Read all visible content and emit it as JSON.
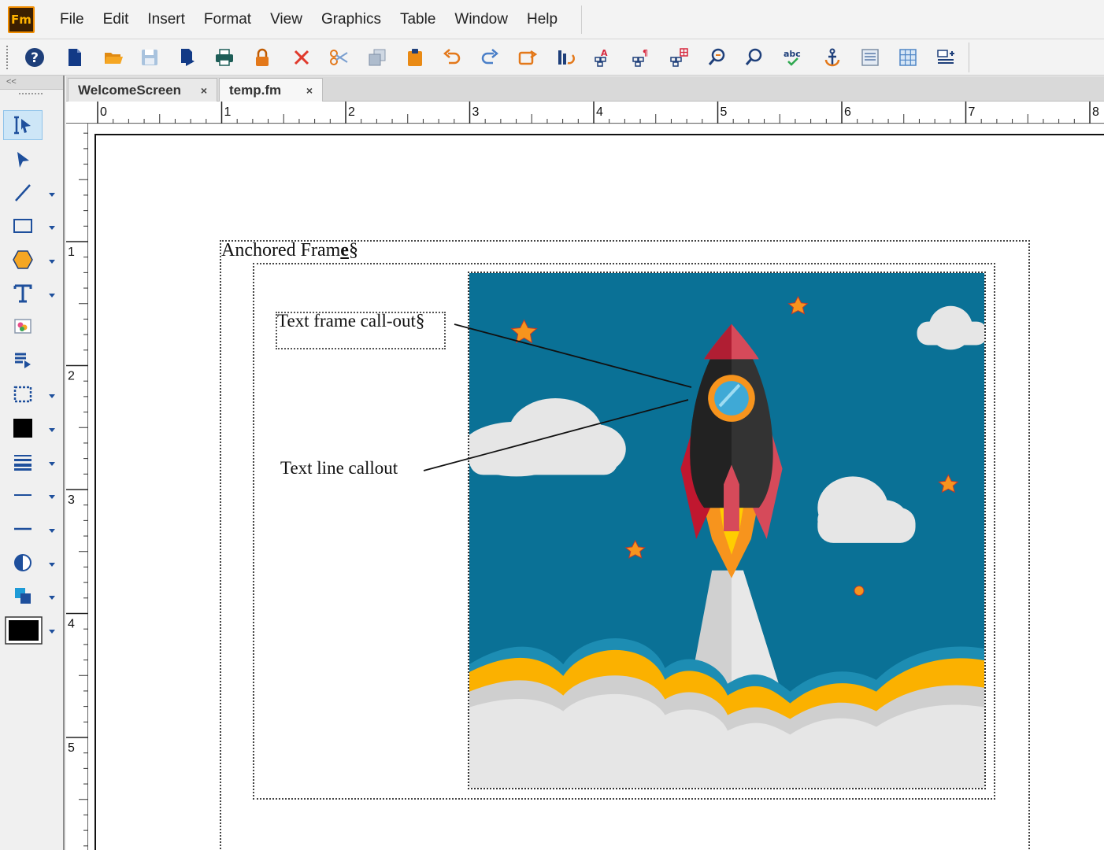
{
  "app": {
    "logo_text": "Fm"
  },
  "menu": {
    "items": [
      "File",
      "Edit",
      "Insert",
      "Format",
      "View",
      "Graphics",
      "Table",
      "Window",
      "Help"
    ]
  },
  "tabs": [
    {
      "label": "WelcomeScreen",
      "close": "×"
    },
    {
      "label": "temp.fm",
      "close": "×"
    }
  ],
  "palette": {
    "collapse_label": "<<"
  },
  "ruler": {
    "horizontal": [
      "0",
      "1",
      "2",
      "3",
      "4",
      "5",
      "6",
      "7",
      "8"
    ],
    "vertical": [
      "1",
      "2",
      "3",
      "4",
      "5"
    ]
  },
  "document": {
    "anchored_frame_label": "Anchored Fram",
    "anchored_frame_tail": "e",
    "anchored_frame_mark": "§",
    "text_frame_callout": "Text frame call-out§",
    "text_line_callout": "Text line callout"
  },
  "colors": {
    "sky": "#0a7196",
    "accent_orange": "#f08c00",
    "toolbar_blue": "#1e4f9c"
  }
}
